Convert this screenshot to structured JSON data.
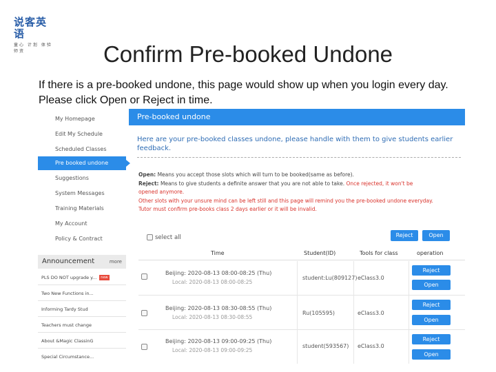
{
  "logo": {
    "main": "说客英语",
    "sub": "童心 计划 体验 师资"
  },
  "slide": {
    "title": "Confirm Pre-booked Undone",
    "desc_line1": "If there is a pre-booked undone, this page would show up when you login every day.",
    "desc_line2": "Please click Open or Reject in time."
  },
  "sidebar": {
    "items": [
      {
        "label": "My Homepage"
      },
      {
        "label": "Edit My Schedule"
      },
      {
        "label": "Scheduled Classes"
      },
      {
        "label": "Pre booked undone"
      },
      {
        "label": "Suggestions"
      },
      {
        "label": "System Messages"
      },
      {
        "label": "Training Materials"
      },
      {
        "label": "My Account"
      },
      {
        "label": "Policy & Contract"
      }
    ],
    "active_index": 3
  },
  "announcement": {
    "title": "Announcement",
    "more": "more",
    "items": [
      {
        "label": "PLS DO NOT upgrade y...",
        "badge": "new"
      },
      {
        "label": "Two New Functions in..."
      },
      {
        "label": "Informing Tardy Stud"
      },
      {
        "label": "Teachers must change"
      },
      {
        "label": "About &Magic ClassinG"
      },
      {
        "label": "Special Circumstance..."
      }
    ]
  },
  "main": {
    "header": "Pre-booked undone",
    "intro": "Here are your pre-booked classes undone, please handle with them to give students earlier feedback.",
    "rule_open_label": "Open:",
    "rule_open_text": "Means you accept those slots which will turn to be booked(same as before).",
    "rule_reject_label": "Reject:",
    "rule_reject_text": "Means to give students a definite answer that you are not able to take.",
    "rule_reject_warn_1": "Once rejected, it won't be",
    "rule_reject_warn_2": "opened anymore.",
    "rule_other": "Other slots with your unsure mind can be left still and this page will remind you the pre-booked undone everyday.",
    "rule_tutor": "Tutor must confirm pre-books class 2 days earlier or it will be invalid.",
    "reject_all": "Reject",
    "open_all": "Open",
    "select_all": "select all"
  },
  "table": {
    "headers": {
      "time": "Time",
      "student": "Student(ID)",
      "tools": "Tools for class",
      "operation": "operation"
    },
    "reject_label": "Reject",
    "open_label": "Open",
    "rows": [
      {
        "time": "Beijing: 2020-08-13 08:00-08:25 (Thu)",
        "local": "Local: 2020-08-13 08:00-08:25",
        "student": "student:Lu(809127)",
        "tools": "eClass3.0"
      },
      {
        "time": "Beijing: 2020-08-13 08:30-08:55 (Thu)",
        "local": "Local: 2020-08-13 08:30-08:55",
        "student": "Ru(105595)",
        "tools": "eClass3.0"
      },
      {
        "time": "Beijing: 2020-08-13 09:00-09:25 (Thu)",
        "local": "Local: 2020-08-13 09:00-09:25",
        "student": "student(593567)",
        "tools": "eClass3.0"
      }
    ]
  },
  "colors": {
    "accent": "#2b8ce8",
    "warning": "#d9322b",
    "intro_text": "#2f6db5"
  }
}
